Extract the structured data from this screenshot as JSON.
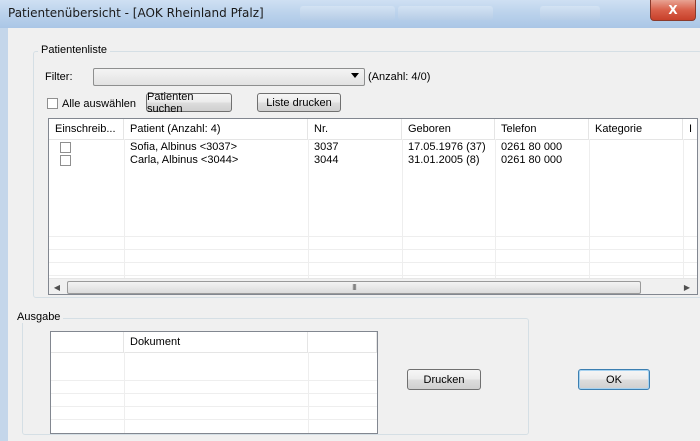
{
  "window": {
    "title": "Patientenübersicht - [AOK Rheinland Pfalz]",
    "close_glyph": "X"
  },
  "patient_list": {
    "group_label": "Patientenliste",
    "filter_label": "Filter:",
    "filter_value": "",
    "count_text": "(Anzahl: 4/0)",
    "select_all_label": "Alle auswählen",
    "search_button": "Patienten suchen",
    "print_list_button": "Liste drucken",
    "columns": [
      "Einschreib...",
      "Patient (Anzahl: 4)",
      "Nr.",
      "Geboren",
      "Telefon",
      "Kategorie",
      "I"
    ],
    "rows": [
      {
        "patient": "Sofia,  Albinus <3037>",
        "nr": "3037",
        "born": "17.05.1976 (37)",
        "phone": "0261 80 000",
        "category": ""
      },
      {
        "patient": "Carla,  Albinus <3044>",
        "nr": "3044",
        "born": "31.01.2005 (8)",
        "phone": "0261 80 000",
        "category": ""
      }
    ],
    "scroll_left": "◀",
    "scroll_right": "▶",
    "thumb_grip": "III"
  },
  "output": {
    "group_label": "Ausgabe",
    "columns": [
      "",
      "Dokument",
      ""
    ],
    "print_button": "Drucken"
  },
  "ok_button": "OK"
}
